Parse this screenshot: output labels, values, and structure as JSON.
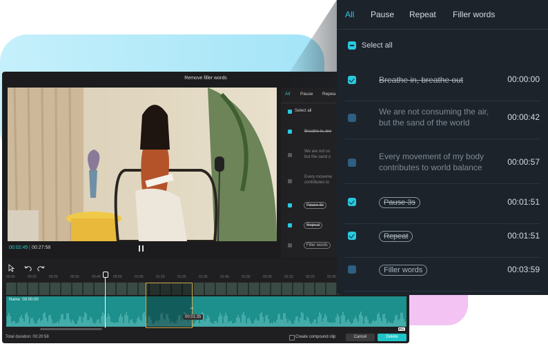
{
  "colors": {
    "accent": "#29c9e0",
    "delete_button": "#1fc4c8",
    "timeline_audio": "#1d8f8c"
  },
  "editor": {
    "title": "Remove filler words",
    "current_time": "00:02:45",
    "separator": "|",
    "total_time": "00:27:58",
    "ruler_ticks": [
      "00:00",
      "00:10",
      "00:20",
      "00:30",
      "00:40",
      "00:50",
      "01:00",
      "01:10",
      "01:20",
      "01:30",
      "01:40",
      "01:50",
      "02:00",
      "02:10",
      "02:20",
      "02:30",
      "02:40",
      "02:50",
      "03:00"
    ],
    "audio_track_name": "Name",
    "audio_track_time": "00:00:00",
    "drag_time": "00:01:35",
    "total_duration": "Total duration: 00:20:58",
    "create_compound_clip": "Create compound clip",
    "cancel": "Cancel",
    "delete": "Delete",
    "pro_badge": "Pro",
    "mini_tabs": [
      "All",
      "Pause",
      "Repea"
    ],
    "mini_select_all": "Select all",
    "mini_rows": [
      {
        "text": "Breathe in, bre",
        "checked": true,
        "pill": false
      },
      {
        "text": "We are not co|but the sand o",
        "checked": false,
        "pill": false
      },
      {
        "text": "Every moveme|contributes to",
        "checked": false,
        "pill": false
      },
      {
        "text": "Pause 3s",
        "checked": true,
        "pill": true
      },
      {
        "text": "Repeat",
        "checked": true,
        "pill": true
      },
      {
        "text": "Filler words",
        "checked": false,
        "pill": true
      }
    ]
  },
  "panel": {
    "tabs": [
      "All",
      "Pause",
      "Repeat",
      "Filler words"
    ],
    "active_tab": "All",
    "select_all": "Select all",
    "rows": [
      {
        "text": "Breathe in, breathe out",
        "time": "00:00:00",
        "checked": true,
        "style": "struck"
      },
      {
        "text_line1": "We are not consuming the air,",
        "text_line2": "but the sand of the world",
        "time": "00:00:42",
        "checked": false,
        "style": "plain"
      },
      {
        "text_line1": "Every movement of my body",
        "text_line2": "contributes to world balance",
        "time": "00:00:57",
        "checked": false,
        "style": "plain"
      },
      {
        "text": "Pause 3s",
        "time": "00:01:51",
        "checked": true,
        "style": "pill-struck"
      },
      {
        "text": "Repeat",
        "time": "00:01:51",
        "checked": true,
        "style": "pill-struck"
      },
      {
        "text": "Filler words",
        "time": "00:03:59",
        "checked": false,
        "style": "pill"
      }
    ]
  }
}
